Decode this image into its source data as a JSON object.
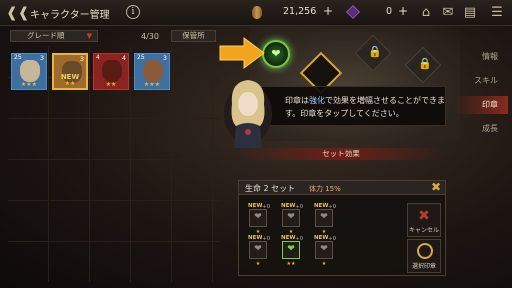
{
  "header": {
    "back_icon": "back-arrow-icon",
    "title": "キャラクター管理",
    "info_label": "i",
    "gold": "21,256",
    "gems": "0",
    "plus": "+",
    "icons": [
      "home-icon",
      "mail-icon",
      "chat-icon",
      "menu-icon"
    ]
  },
  "list": {
    "filter_label": "グレード順",
    "count": "4/30",
    "storage_label": "保管所",
    "cards": [
      {
        "level": "25",
        "num": "3",
        "stars": "★★★",
        "new": "",
        "color": "#3e6f9f"
      },
      {
        "level": "",
        "num": "3",
        "stars": "★★",
        "new": "NEW",
        "color": "#a06a2a"
      },
      {
        "level": "4",
        "num": "4",
        "stars": "★★",
        "new": "",
        "color": "#8a2420"
      },
      {
        "level": "25",
        "num": "3",
        "stars": "★★★",
        "new": "",
        "color": "#3e6f9f"
      }
    ]
  },
  "tooltip": {
    "line1_pre": "印章は",
    "line1_hl": "強化",
    "line1_post": "で効果を増幅させることができま",
    "line2": "す。印章をタップしてください。"
  },
  "side_menu": [
    {
      "label": "情報",
      "active": false
    },
    {
      "label": "スキル",
      "active": false
    },
    {
      "label": "印章",
      "active": true
    },
    {
      "label": "成長",
      "active": false
    }
  ],
  "set_effect": {
    "bar_label": "セット効果",
    "name": "生命 2 セット",
    "stat": "体力 15%",
    "close_icon": "close-icon",
    "mini_seals": [
      {
        "new": "NEW",
        "count": "+0",
        "stars": "★"
      },
      {
        "new": "NEW",
        "count": "+0",
        "stars": "★"
      },
      {
        "new": "NEW",
        "count": "+0",
        "stars": "★"
      },
      {
        "new": "NEW",
        "count": "+0",
        "stars": "★"
      },
      {
        "new": "NEW",
        "count": "+0",
        "stars": "★★"
      },
      {
        "new": "NEW",
        "count": "+0",
        "stars": "★"
      }
    ],
    "cancel_label": "キャンセル",
    "select_label": "選択印章"
  },
  "colors": {
    "accent": "#d4a53a",
    "active_tab": "#8b2a1f",
    "seal_glow": "#6fd24a"
  }
}
